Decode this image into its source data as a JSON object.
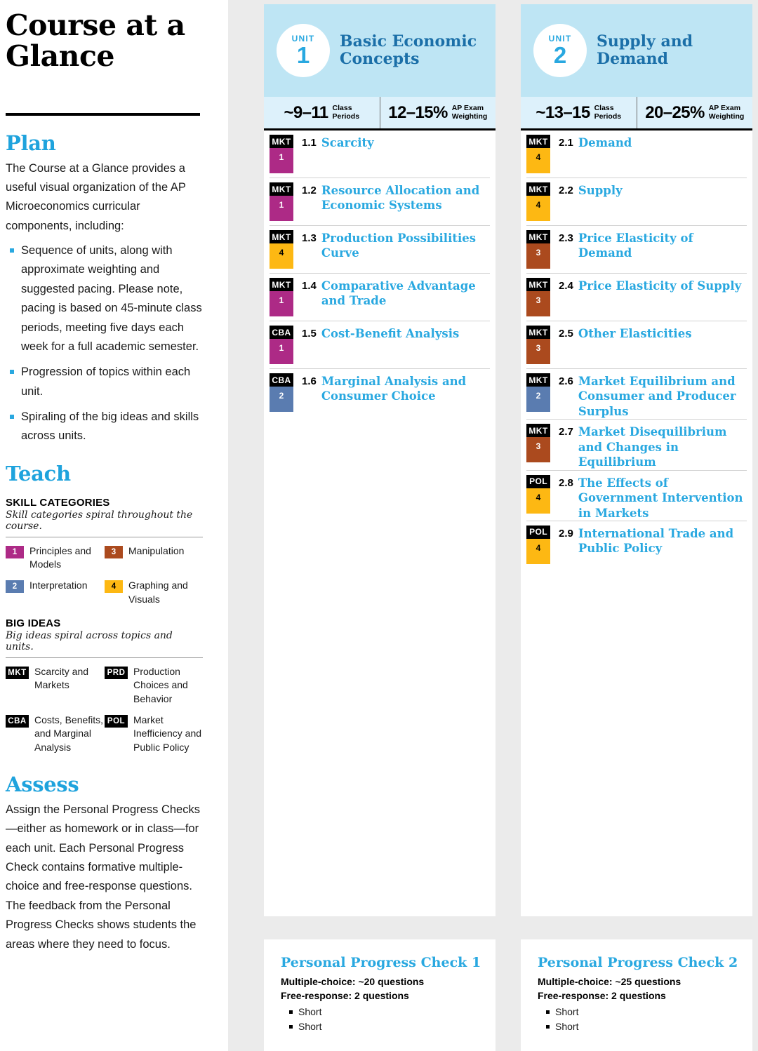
{
  "doc": {
    "title": "Course at a Glance"
  },
  "plan": {
    "heading": "Plan",
    "intro": "The Course at a Glance provides a useful visual organization of the AP Microeconomics curricular components, including:",
    "bullets": [
      "Sequence of units, along with approximate weighting and suggested pacing. Please note, pacing is based on 45-minute class periods, meeting five days each week for a full academic semester.",
      "Progression of topics within each unit.",
      "Spiraling of the big ideas and skills across units."
    ]
  },
  "teach": {
    "heading": "Teach",
    "skill_categories": {
      "label": "SKILL CATEGORIES",
      "note": "Skill categories spiral throughout the course.",
      "items": [
        {
          "code": "1",
          "label": "Principles and Models",
          "color": "#ad2a86"
        },
        {
          "code": "3",
          "label": "Manipulation",
          "color": "#ab4a1e"
        },
        {
          "code": "2",
          "label": "Interpretation",
          "color": "#5a7cb0"
        },
        {
          "code": "4",
          "label": "Graphing and Visuals",
          "color": "#fdb813"
        }
      ]
    },
    "big_ideas": {
      "label": "BIG IDEAS",
      "note": "Big ideas spiral across topics and units.",
      "items": [
        {
          "code": "MKT",
          "label": "Scarcity and Markets"
        },
        {
          "code": "PRD",
          "label": "Production Choices and Behavior"
        },
        {
          "code": "CBA",
          "label": "Costs, Benefits, and Marginal Analysis"
        },
        {
          "code": "POL",
          "label": "Market Inefficiency and Public Policy"
        }
      ]
    }
  },
  "assess": {
    "heading": "Assess",
    "text": "Assign the Personal Progress Checks—either as homework or in class—for each unit. Each Personal Progress Check contains formative multiple-choice and free-response questions. The feedback from the Personal Progress Checks shows students the areas where they need to focus."
  },
  "colors": {
    "accent_blue": "#29a8e0",
    "unit_header_blue": "#bee5f4",
    "unit_stats_blue": "#ddf1fb",
    "title_blue": "#1b6fa8",
    "skill_1": "#ad2a86",
    "skill_2": "#5a7cb0",
    "skill_3": "#ab4a1e",
    "skill_4": "#fdb813",
    "page_bg": "#ebebeb"
  },
  "units": [
    {
      "kicker": "UNIT",
      "number": "1",
      "title": "Basic Economic Concepts",
      "class_periods_value": "~9–11",
      "class_periods_label_1": "Class",
      "class_periods_label_2": "Periods",
      "exam_weight_value": "12–15%",
      "exam_weight_label_1": "AP Exam",
      "exam_weight_label_2": "Weighting",
      "topics": [
        {
          "big_idea": "MKT",
          "skill": "1",
          "skill_color": "#ad2a86",
          "num": "1.1",
          "name": "Scarcity"
        },
        {
          "big_idea": "MKT",
          "skill": "1",
          "skill_color": "#ad2a86",
          "num": "1.2",
          "name": "Resource Allocation and Economic Systems"
        },
        {
          "big_idea": "MKT",
          "skill": "4",
          "skill_color": "#fdb813",
          "num": "1.3",
          "name": "Production Possibilities Curve"
        },
        {
          "big_idea": "MKT",
          "skill": "1",
          "skill_color": "#ad2a86",
          "num": "1.4",
          "name": "Comparative Advantage and Trade"
        },
        {
          "big_idea": "CBA",
          "skill": "1",
          "skill_color": "#ad2a86",
          "num": "1.5",
          "name": "Cost-Benefit Analysis"
        },
        {
          "big_idea": "CBA",
          "skill": "2",
          "skill_color": "#5a7cb0",
          "num": "1.6",
          "name": "Marginal Analysis and Consumer Choice"
        }
      ],
      "ppc": {
        "title": "Personal Progress Check 1",
        "mc": "Multiple-choice: ~20 questions",
        "fr": "Free-response: 2 questions",
        "fr_items": [
          "Short",
          "Short"
        ]
      }
    },
    {
      "kicker": "UNIT",
      "number": "2",
      "title": "Supply and Demand",
      "class_periods_value": "~13–15",
      "class_periods_label_1": "Class",
      "class_periods_label_2": "Periods",
      "exam_weight_value": "20–25%",
      "exam_weight_label_1": "AP Exam",
      "exam_weight_label_2": "Weighting",
      "topics": [
        {
          "big_idea": "MKT",
          "skill": "4",
          "skill_color": "#fdb813",
          "num": "2.1",
          "name": "Demand"
        },
        {
          "big_idea": "MKT",
          "skill": "4",
          "skill_color": "#fdb813",
          "num": "2.2",
          "name": "Supply"
        },
        {
          "big_idea": "MKT",
          "skill": "3",
          "skill_color": "#ab4a1e",
          "num": "2.3",
          "name": "Price Elasticity of Demand"
        },
        {
          "big_idea": "MKT",
          "skill": "3",
          "skill_color": "#ab4a1e",
          "num": "2.4",
          "name": "Price Elasticity of Supply"
        },
        {
          "big_idea": "MKT",
          "skill": "3",
          "skill_color": "#ab4a1e",
          "num": "2.5",
          "name": "Other Elasticities"
        },
        {
          "big_idea": "MKT",
          "skill": "2",
          "skill_color": "#5a7cb0",
          "num": "2.6",
          "name": "Market Equilibrium and Consumer and Producer Surplus"
        },
        {
          "big_idea": "MKT",
          "skill": "3",
          "skill_color": "#ab4a1e",
          "num": "2.7",
          "name": "Market Disequilibrium and Changes in Equilibrium"
        },
        {
          "big_idea": "POL",
          "skill": "4",
          "skill_color": "#fdb813",
          "num": "2.8",
          "name": "The Effects of Government Intervention in Markets"
        },
        {
          "big_idea": "POL",
          "skill": "4",
          "skill_color": "#fdb813",
          "num": "2.9",
          "name": "International Trade and Public Policy"
        }
      ],
      "ppc": {
        "title": "Personal Progress Check 2",
        "mc": "Multiple-choice: ~25 questions",
        "fr": "Free-response: 2 questions",
        "fr_items": [
          "Short",
          "Short"
        ]
      }
    }
  ]
}
